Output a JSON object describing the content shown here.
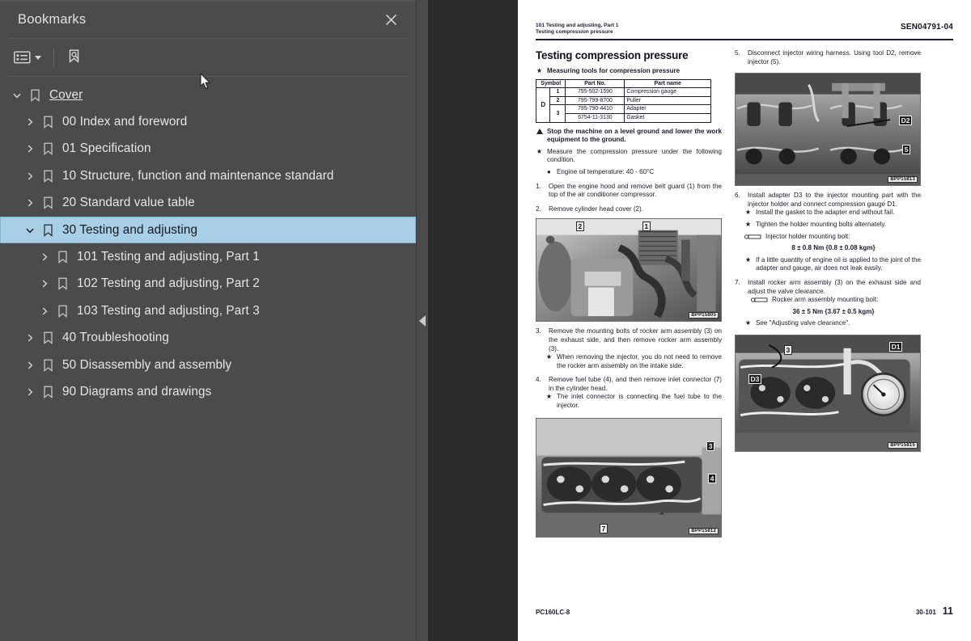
{
  "panel": {
    "title": "Bookmarks",
    "close_icon": "close-icon",
    "toolbar": {
      "options_label": "list-options-icon",
      "find_label": "bookmark-find-icon"
    },
    "items": [
      {
        "label": "Cover",
        "depth": 0,
        "twisty": "down",
        "selected": false,
        "underline": true
      },
      {
        "label": "00 Index and foreword",
        "depth": 1,
        "twisty": "right",
        "selected": false,
        "underline": false
      },
      {
        "label": "01 Specification",
        "depth": 1,
        "twisty": "right",
        "selected": false,
        "underline": false
      },
      {
        "label": "10 Structure, function and maintenance standard",
        "depth": 1,
        "twisty": "right",
        "selected": false,
        "underline": false
      },
      {
        "label": "20 Standard value table",
        "depth": 1,
        "twisty": "right",
        "selected": false,
        "underline": false
      },
      {
        "label": "30 Testing and adjusting",
        "depth": 1,
        "twisty": "down",
        "selected": true,
        "underline": false
      },
      {
        "label": "101 Testing and adjusting, Part 1",
        "depth": 2,
        "twisty": "right",
        "selected": false,
        "underline": false
      },
      {
        "label": "102 Testing and adjusting, Part 2",
        "depth": 2,
        "twisty": "right",
        "selected": false,
        "underline": false
      },
      {
        "label": "103 Testing and adjusting, Part 3",
        "depth": 2,
        "twisty": "right",
        "selected": false,
        "underline": false
      },
      {
        "label": "40 Troubleshooting",
        "depth": 1,
        "twisty": "right",
        "selected": false,
        "underline": false
      },
      {
        "label": "50 Disassembly and assembly",
        "depth": 1,
        "twisty": "right",
        "selected": false,
        "underline": false
      },
      {
        "label": "90 Diagrams and drawings",
        "depth": 1,
        "twisty": "right",
        "selected": false,
        "underline": false
      }
    ],
    "collapse_handle": "collapse-panel-icon"
  },
  "colors": {
    "panel_bg": "#4b4b4b",
    "viewer_bg": "#2b2b2b",
    "selection": "#a8cfe5",
    "page": "#ffffff",
    "text": "#e6e6e6"
  },
  "page": {
    "header": {
      "line1": "101 Testing and adjusting, Part 1",
      "line2": "Testing compression pressure",
      "doc_code": "SEN04791-04"
    },
    "title": "Testing compression pressure",
    "tools_intro": "Measuring tools for compression pressure",
    "tools_table": {
      "columns": [
        "Symbol",
        "Part No.",
        "Part name"
      ],
      "symbol": "D",
      "rows": [
        {
          "idx": "1",
          "part_no": "795-502-1590",
          "part_name": "Compression gauge"
        },
        {
          "idx": "2",
          "part_no": "795-799-8700",
          "part_name": "Puller"
        },
        {
          "idx": "3",
          "part_no": "795-790-4410",
          "part_name": "Adapter"
        },
        {
          "idx": "",
          "part_no": "6754-11-3130",
          "part_name": "Gasket"
        }
      ]
    },
    "warning": "Stop the machine on a level ground and lower the work equipment to the ground.",
    "star_measure": "Measure the compression pressure under the following condition.",
    "bullet_temp": "Engine oil temperature: 40 - 60°C",
    "steps_left": [
      {
        "n": "1.",
        "text": "Open the engine hood and remove belt guard (1) from the top of the air conditioner compressor."
      },
      {
        "n": "2.",
        "text": "Remove cylinder head cover (2)."
      }
    ],
    "step3": {
      "n": "3.",
      "text": "Remove the mounting bolts of rocker arm assembly (3) on the exhaust side, and then remove rocker arm assembly (3).",
      "star": "When removing the injector, you do not need to remove the rocker arm assembly on the intake side."
    },
    "step4": {
      "n": "4.",
      "text": "Remove fuel tube (4), and then remove inlet connector (7) in the cylinder head.",
      "star": "The inlet connector is connecting the fuel tube to the injector."
    },
    "step5": {
      "n": "5.",
      "text": "Disconnect injector wiring harness. Using tool D2, remove injector (5)."
    },
    "step6": {
      "n": "6.",
      "text": "Install adapter D3 to the injector mounting part with the injector holder and connect compression gauge D1.",
      "star1": "Install the gasket to the adapter end without fail.",
      "star2": "Tighten the holder mounting bolts alternately.",
      "torque_label": "Injector holder mounting bolt:",
      "torque_value": "8 ± 0.8 Nm {0.8 ± 0.08 kgm}",
      "star3": "If a little quantity of engine oil is applied to the joint of the adapter and gauge, air does not leak easily."
    },
    "step7": {
      "n": "7.",
      "text": "Install rocker arm assembly (3) on the exhaust side and adjust the valve clearance.",
      "torque_label": "Rocker arm assembly mounting bolt:",
      "torque_value": "36 ± 5 Nm {3.67 ± 0.5 kgm}",
      "star": "See \"Adjusting valve clearance\"."
    },
    "photos": [
      {
        "name": "engine-compartment-photo",
        "code": "BPP15805",
        "callouts": [
          "2",
          "1"
        ]
      },
      {
        "name": "cylinder-head-top-photo",
        "code": "BPP15812",
        "callouts": [
          "3",
          "4",
          "7"
        ]
      },
      {
        "name": "injector-removal-photo",
        "code": "BPP15813",
        "callouts": [
          "D2",
          "5"
        ]
      },
      {
        "name": "adapter-gauge-photo",
        "code": "BPP15815",
        "callouts": [
          "D1",
          "D3",
          "3"
        ]
      }
    ],
    "footer": {
      "model": "PC160LC-8",
      "section": "30-101",
      "page_number": "11"
    }
  }
}
